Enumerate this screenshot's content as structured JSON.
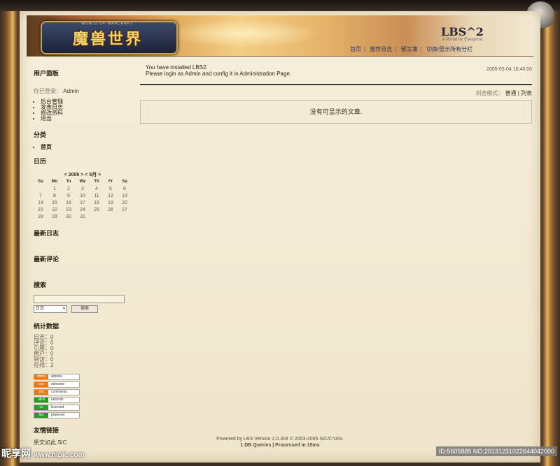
{
  "header": {
    "logo_text": "魔兽世界",
    "logo_sub": "WORLD OF WARCRAFT",
    "site_title": "LBS^2",
    "site_sub": "A Portal for Everyone",
    "nav": [
      "首页",
      "推荐日志",
      "留言簿",
      "切换/显示所有分栏"
    ]
  },
  "sidebar": {
    "user_panel_title": "用户面板",
    "login_status_label": "你已登录：",
    "login_user": "Admin",
    "user_links": [
      "后台管理",
      "发表日志",
      "修改资料",
      "退出"
    ],
    "category_title": "分类",
    "categories": [
      "首页"
    ],
    "calendar_title": "日历",
    "calendar_nav": "< 2006 >  < 5月 >",
    "weekdays": [
      "Su",
      "Mo",
      "Tu",
      "We",
      "Th",
      "Fr",
      "Sa"
    ],
    "weeks": [
      [
        "",
        "1",
        "2",
        "3",
        "4",
        "5",
        "6"
      ],
      [
        "7",
        "8",
        "9",
        "10",
        "11",
        "12",
        "13"
      ],
      [
        "14",
        "15",
        "16",
        "17",
        "18",
        "19",
        "20"
      ],
      [
        "21",
        "22",
        "23",
        "24",
        "25",
        "26",
        "27"
      ],
      [
        "28",
        "29",
        "30",
        "31",
        "",
        "",
        ""
      ]
    ],
    "latest_posts_title": "最新日志",
    "latest_comments_title": "最新评论",
    "search_title": "搜索",
    "search_select_value": "日志",
    "search_button": "搜索",
    "stats_title": "统计数据",
    "stats": [
      "日志：0",
      "评论：0",
      "引用：0",
      "用户：0",
      "到访：0",
      "在线：2"
    ],
    "badges": [
      {
        "left": "xhtml",
        "right": "articles",
        "color": "#e87a1a"
      },
      {
        "left": "css",
        "right": "selected",
        "color": "#e87a1a"
      },
      {
        "left": "rss",
        "right": "comments",
        "color": "#e87a1a"
      },
      {
        "left": "utf-8",
        "right": "unicode",
        "color": "#2a9a2a"
      },
      {
        "left": "cc",
        "right": "licensed",
        "color": "#2a9a2a"
      },
      {
        "left": "lbs",
        "right": "powered",
        "color": "#2a9a2a"
      }
    ],
    "links_title": "友情链接",
    "links": [
      "原文如此.SIC"
    ]
  },
  "main": {
    "notice_line1": "You have installed LBS2.",
    "notice_line2": "Please login as Admin and config it in Administration Page.",
    "date": "2005-03-04 16:46:00",
    "view_mode_label": "浏览模式：",
    "view_mode_normal": "普通",
    "view_mode_sep": "|",
    "view_mode_list": "列表",
    "empty_message": "没有可显示的文章."
  },
  "footer": {
    "line1": "Powered by LBS Version 2.0.304 © 2003-2005 SIC/CYAN.",
    "line2": "1 DB Queries | Processed in 15ms"
  },
  "watermark": {
    "left_brand": "昵享网",
    "left_url": "www.nipic.com",
    "right_id": "ID:5605889 NO:20131231022644042000"
  }
}
